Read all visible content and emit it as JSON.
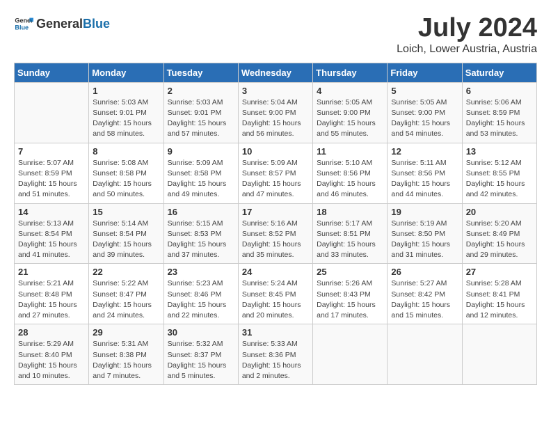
{
  "header": {
    "logo_general": "General",
    "logo_blue": "Blue",
    "title": "July 2024",
    "location": "Loich, Lower Austria, Austria"
  },
  "columns": [
    "Sunday",
    "Monday",
    "Tuesday",
    "Wednesday",
    "Thursday",
    "Friday",
    "Saturday"
  ],
  "weeks": [
    [
      {
        "day": "",
        "info": ""
      },
      {
        "day": "1",
        "info": "Sunrise: 5:03 AM\nSunset: 9:01 PM\nDaylight: 15 hours\nand 58 minutes."
      },
      {
        "day": "2",
        "info": "Sunrise: 5:03 AM\nSunset: 9:01 PM\nDaylight: 15 hours\nand 57 minutes."
      },
      {
        "day": "3",
        "info": "Sunrise: 5:04 AM\nSunset: 9:00 PM\nDaylight: 15 hours\nand 56 minutes."
      },
      {
        "day": "4",
        "info": "Sunrise: 5:05 AM\nSunset: 9:00 PM\nDaylight: 15 hours\nand 55 minutes."
      },
      {
        "day": "5",
        "info": "Sunrise: 5:05 AM\nSunset: 9:00 PM\nDaylight: 15 hours\nand 54 minutes."
      },
      {
        "day": "6",
        "info": "Sunrise: 5:06 AM\nSunset: 8:59 PM\nDaylight: 15 hours\nand 53 minutes."
      }
    ],
    [
      {
        "day": "7",
        "info": "Sunrise: 5:07 AM\nSunset: 8:59 PM\nDaylight: 15 hours\nand 51 minutes."
      },
      {
        "day": "8",
        "info": "Sunrise: 5:08 AM\nSunset: 8:58 PM\nDaylight: 15 hours\nand 50 minutes."
      },
      {
        "day": "9",
        "info": "Sunrise: 5:09 AM\nSunset: 8:58 PM\nDaylight: 15 hours\nand 49 minutes."
      },
      {
        "day": "10",
        "info": "Sunrise: 5:09 AM\nSunset: 8:57 PM\nDaylight: 15 hours\nand 47 minutes."
      },
      {
        "day": "11",
        "info": "Sunrise: 5:10 AM\nSunset: 8:56 PM\nDaylight: 15 hours\nand 46 minutes."
      },
      {
        "day": "12",
        "info": "Sunrise: 5:11 AM\nSunset: 8:56 PM\nDaylight: 15 hours\nand 44 minutes."
      },
      {
        "day": "13",
        "info": "Sunrise: 5:12 AM\nSunset: 8:55 PM\nDaylight: 15 hours\nand 42 minutes."
      }
    ],
    [
      {
        "day": "14",
        "info": "Sunrise: 5:13 AM\nSunset: 8:54 PM\nDaylight: 15 hours\nand 41 minutes."
      },
      {
        "day": "15",
        "info": "Sunrise: 5:14 AM\nSunset: 8:54 PM\nDaylight: 15 hours\nand 39 minutes."
      },
      {
        "day": "16",
        "info": "Sunrise: 5:15 AM\nSunset: 8:53 PM\nDaylight: 15 hours\nand 37 minutes."
      },
      {
        "day": "17",
        "info": "Sunrise: 5:16 AM\nSunset: 8:52 PM\nDaylight: 15 hours\nand 35 minutes."
      },
      {
        "day": "18",
        "info": "Sunrise: 5:17 AM\nSunset: 8:51 PM\nDaylight: 15 hours\nand 33 minutes."
      },
      {
        "day": "19",
        "info": "Sunrise: 5:19 AM\nSunset: 8:50 PM\nDaylight: 15 hours\nand 31 minutes."
      },
      {
        "day": "20",
        "info": "Sunrise: 5:20 AM\nSunset: 8:49 PM\nDaylight: 15 hours\nand 29 minutes."
      }
    ],
    [
      {
        "day": "21",
        "info": "Sunrise: 5:21 AM\nSunset: 8:48 PM\nDaylight: 15 hours\nand 27 minutes."
      },
      {
        "day": "22",
        "info": "Sunrise: 5:22 AM\nSunset: 8:47 PM\nDaylight: 15 hours\nand 24 minutes."
      },
      {
        "day": "23",
        "info": "Sunrise: 5:23 AM\nSunset: 8:46 PM\nDaylight: 15 hours\nand 22 minutes."
      },
      {
        "day": "24",
        "info": "Sunrise: 5:24 AM\nSunset: 8:45 PM\nDaylight: 15 hours\nand 20 minutes."
      },
      {
        "day": "25",
        "info": "Sunrise: 5:26 AM\nSunset: 8:43 PM\nDaylight: 15 hours\nand 17 minutes."
      },
      {
        "day": "26",
        "info": "Sunrise: 5:27 AM\nSunset: 8:42 PM\nDaylight: 15 hours\nand 15 minutes."
      },
      {
        "day": "27",
        "info": "Sunrise: 5:28 AM\nSunset: 8:41 PM\nDaylight: 15 hours\nand 12 minutes."
      }
    ],
    [
      {
        "day": "28",
        "info": "Sunrise: 5:29 AM\nSunset: 8:40 PM\nDaylight: 15 hours\nand 10 minutes."
      },
      {
        "day": "29",
        "info": "Sunrise: 5:31 AM\nSunset: 8:38 PM\nDaylight: 15 hours\nand 7 minutes."
      },
      {
        "day": "30",
        "info": "Sunrise: 5:32 AM\nSunset: 8:37 PM\nDaylight: 15 hours\nand 5 minutes."
      },
      {
        "day": "31",
        "info": "Sunrise: 5:33 AM\nSunset: 8:36 PM\nDaylight: 15 hours\nand 2 minutes."
      },
      {
        "day": "",
        "info": ""
      },
      {
        "day": "",
        "info": ""
      },
      {
        "day": "",
        "info": ""
      }
    ]
  ]
}
